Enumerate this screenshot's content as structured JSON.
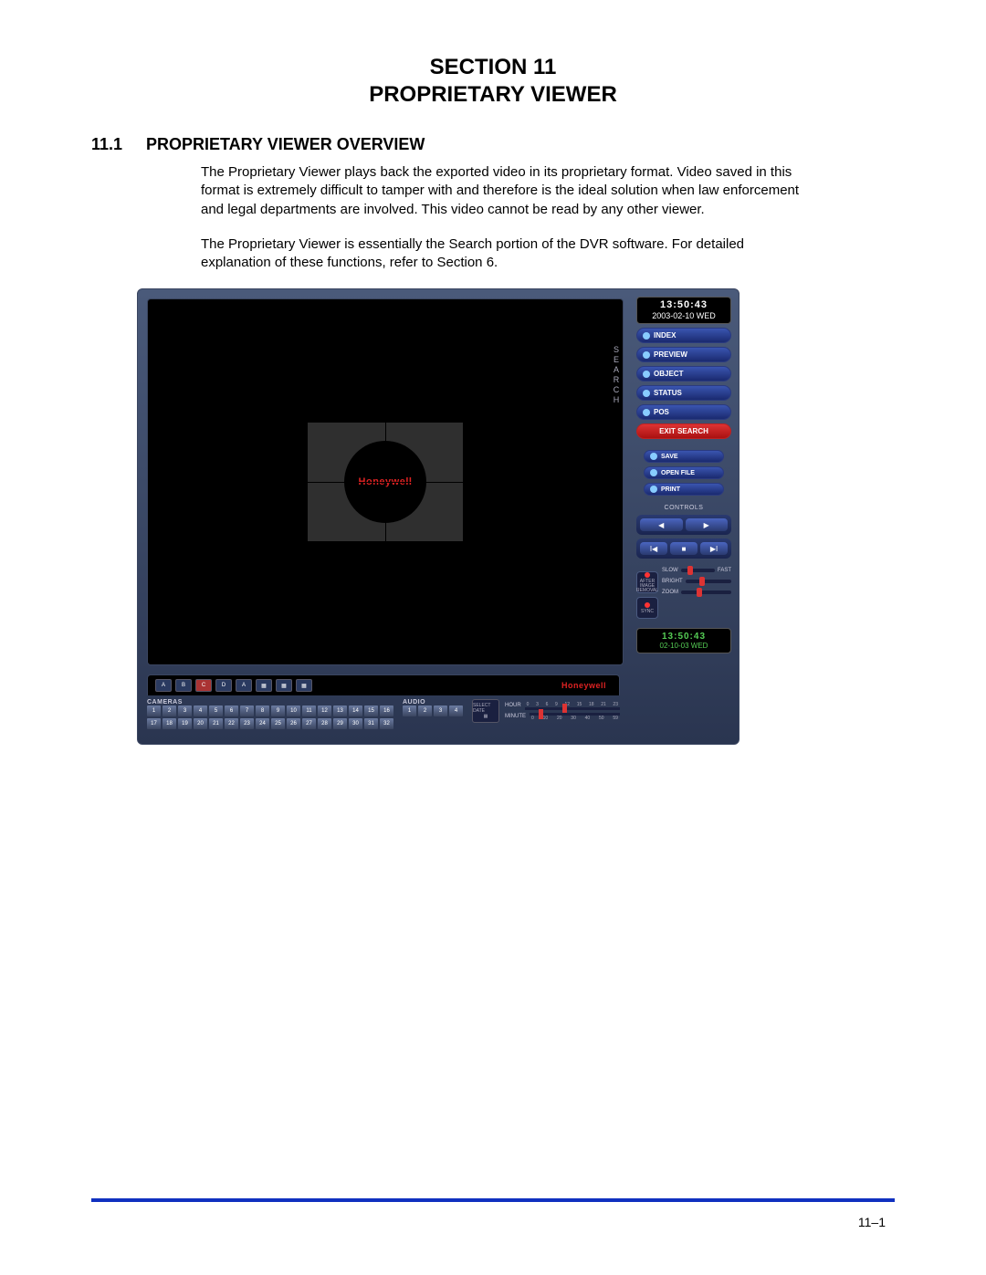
{
  "header": {
    "section_line": "SECTION 11",
    "title": "PROPRIETARY VIEWER"
  },
  "subsection": {
    "number": "11.1",
    "title": "PROPRIETARY VIEWER OVERVIEW"
  },
  "paragraphs": {
    "p1": "The Proprietary Viewer plays back the exported video in its proprietary format. Video saved in this format is extremely difficult to tamper with and therefore is the ideal solution when law enforcement and legal departments are involved. This video cannot be read by any other viewer.",
    "p2": "The Proprietary Viewer is essentially the Search portion of the DVR software. For detailed explanation of these functions, refer to Section 6."
  },
  "viewer": {
    "logo": "Honeywell",
    "search_label": "SEARCH",
    "clock": {
      "time": "13:50:43",
      "date": "2003-02-10  WED"
    },
    "buttons": {
      "index": "INDEX",
      "preview": "PREVIEW",
      "object": "OBJECT",
      "status": "STATUS",
      "pos": "POS",
      "exit": "EXIT SEARCH",
      "save": "SAVE",
      "open": "OPEN FILE",
      "print": "PRINT"
    },
    "controls_label": "CONTROLS",
    "side_buttons": {
      "after_image": "AFTER IMAGE REMOVAL",
      "sync": "SYNC"
    },
    "sliders": {
      "slow": "SLOW",
      "fast": "FAST",
      "bright": "BRIGHT",
      "zoom": "ZOOM"
    },
    "clock2": {
      "time": "13:50:43",
      "date": "02-10-03 WED"
    },
    "layout_letters": [
      "A",
      "B",
      "C",
      "D",
      "A",
      "",
      "",
      ""
    ],
    "brand": "Honeywell",
    "cameras_label": "CAMERAS",
    "audio_label": "AUDIO",
    "cameras_row1": [
      "1",
      "2",
      "3",
      "4",
      "5",
      "6",
      "7",
      "8",
      "9",
      "10",
      "11",
      "12",
      "13",
      "14",
      "15",
      "16"
    ],
    "cameras_row2": [
      "17",
      "18",
      "19",
      "20",
      "21",
      "22",
      "23",
      "24",
      "25",
      "26",
      "27",
      "28",
      "29",
      "30",
      "31",
      "32"
    ],
    "audio_row": [
      "1",
      "2",
      "3",
      "4"
    ],
    "select_date": "SELECT DATE",
    "hour_label": "HOUR",
    "minute_label": "MINUTE",
    "hour_ticks": [
      "0",
      "3",
      "6",
      "9",
      "12",
      "15",
      "18",
      "21",
      "23"
    ],
    "minute_ticks": [
      "0",
      "10",
      "20",
      "30",
      "40",
      "50",
      "59"
    ]
  },
  "page_number": "11–1"
}
